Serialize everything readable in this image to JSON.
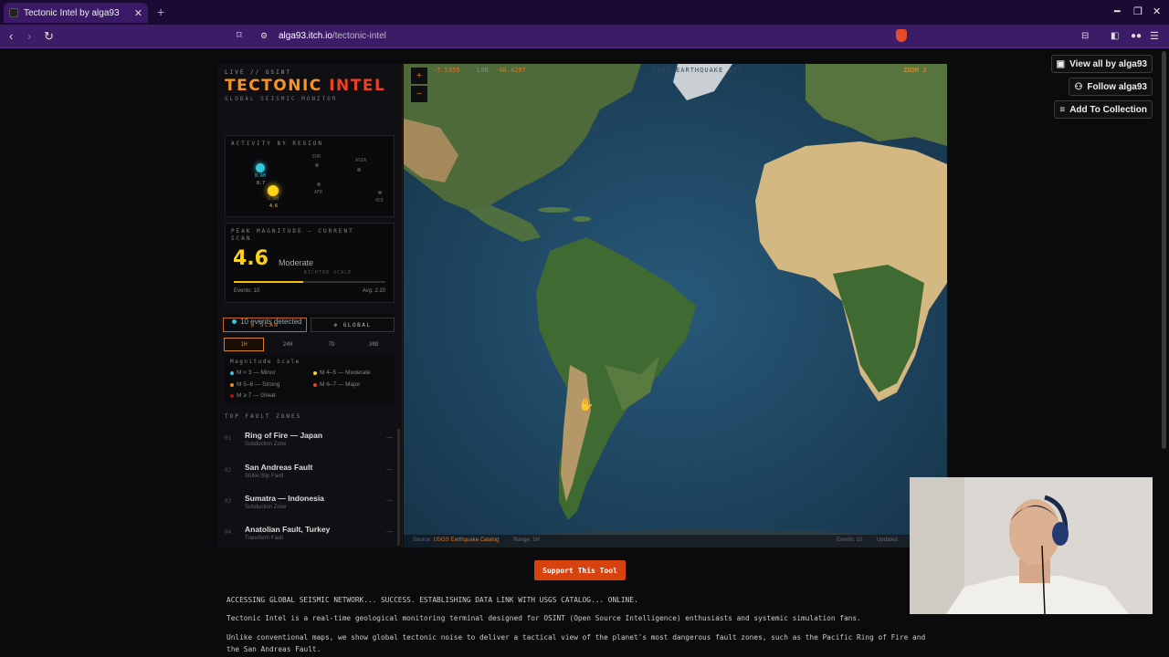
{
  "browser": {
    "tab_title": "Tectonic Intel by alga93",
    "tab_close": "✕",
    "new_tab": "+",
    "url_host": "alga93.itch.io",
    "url_path": "/tectonic-intel"
  },
  "sidebar": {
    "live": "LIVE // OSINT",
    "brand_a": "TECTONIC",
    "brand_b": "INTEL",
    "subtitle": "GLOBAL SEISMIC MONITOR",
    "activity_header": "ACTIVITY BY REGION",
    "regions": [
      {
        "label": "N.AM",
        "value": "8.7"
      },
      {
        "label": "S.AM",
        "value": "4.6"
      },
      {
        "label": "EUR",
        "value": ""
      },
      {
        "label": "ASIA",
        "value": ""
      },
      {
        "label": "AFR",
        "value": ""
      },
      {
        "label": "OCE",
        "value": ""
      }
    ],
    "peak_header": "PEAK MAGNITUDE — CURRENT SCAN",
    "peak_value": "4.6",
    "peak_class": "Moderate",
    "richter": "RICHTER SCALE",
    "peak_fraction": 0.46,
    "events_label": "Events: 10",
    "avg_label": "Avg: 2.10",
    "events_detected": "10 events detected",
    "scan_btn": "◎ SCAN",
    "global_btn": "⊕ GLOBAL",
    "time_tabs": [
      "1H",
      "24H",
      "7D",
      "30D"
    ],
    "legend_header": "Magnitude Scale",
    "legend": [
      {
        "label": "M < 3 — Minor",
        "color": "#38c6de"
      },
      {
        "label": "M 4–5 — Moderate",
        "color": "#ffd21a"
      },
      {
        "label": "M 5–6 — Strong",
        "color": "#f08a24"
      },
      {
        "label": "M 6–7 — Major",
        "color": "#e8421f"
      },
      {
        "label": "M ≥ 7 — Great",
        "color": "#b0141b"
      }
    ],
    "faults_header": "TOP FAULT ZONES",
    "faults": [
      {
        "num": "01",
        "name": "Ring of Fire — Japan",
        "type": "Subduction Zone"
      },
      {
        "num": "02",
        "name": "San Andreas Fault",
        "type": "Strike-Slip Fault"
      },
      {
        "num": "03",
        "name": "Sumatra — Indonesia",
        "type": "Subduction Zone"
      },
      {
        "num": "04",
        "name": "Anatolian Fault, Turkey",
        "type": "Transform Fault"
      }
    ]
  },
  "map": {
    "lat": "-7.5355",
    "lon_label": "LON",
    "lon": "-48.4297",
    "feed": "USGS EARTHQUAKE API",
    "zoom": "ZOOM 3",
    "zoom_in": "+",
    "zoom_out": "−",
    "source_label": "Source:",
    "source": "USGS Earthquake Catalog",
    "range": "Range: 1H",
    "events": "Events: 10",
    "updated": "Updated"
  },
  "right_buttons": {
    "view_all": "View all by alga93",
    "follow": "Follow alga93",
    "collection": "Add To Collection"
  },
  "content": {
    "support": "Support This Tool",
    "line1": "ACCESSING GLOBAL SEISMIC NETWORK... SUCCESS. ESTABLISHING DATA LINK WITH USGS CATALOG... ONLINE.",
    "line2": "Tectonic Intel is a real-time geological monitoring terminal designed for OSINT (Open Source Intelligence) enthusiasts and systemic simulation fans.",
    "line3": "Unlike conventional maps, we show global tectonic noise to deliver a tactical view of the planet's most dangerous fault zones, such as the Pacific Ring of Fire and the San Andreas Fault."
  }
}
